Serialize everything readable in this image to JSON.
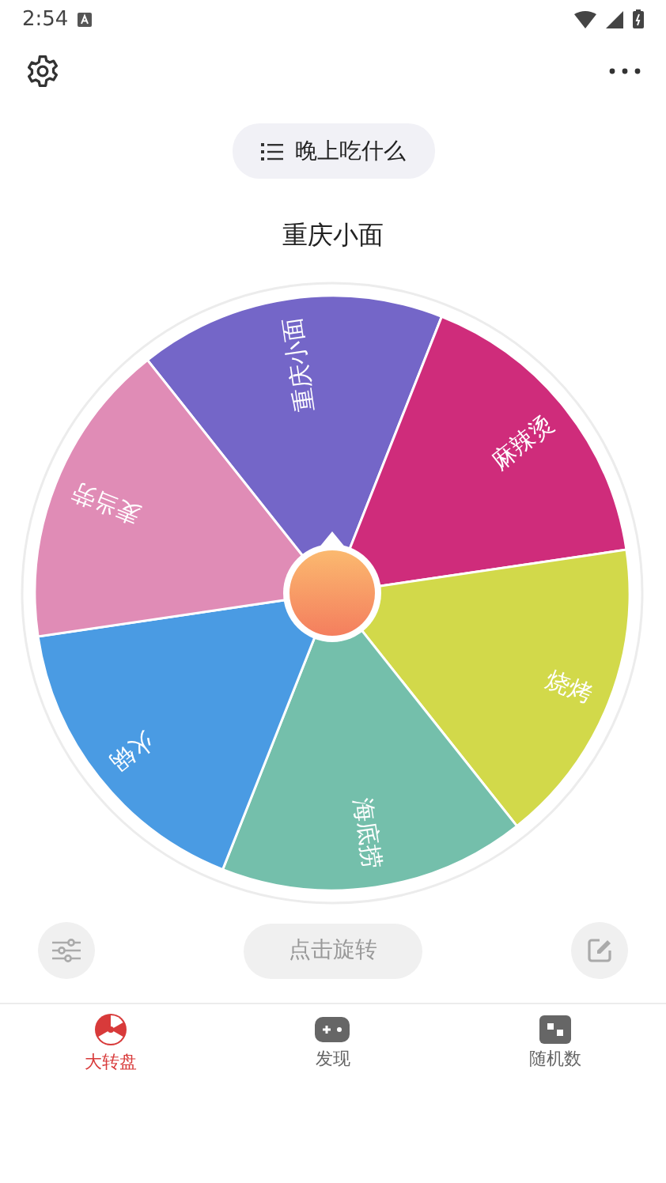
{
  "status_bar": {
    "time": "2:54"
  },
  "list_chip": {
    "label": "晚上吃什么"
  },
  "result": "重庆小面",
  "wheel": {
    "segments": [
      {
        "label": "重庆小面",
        "color": "#7466c8"
      },
      {
        "label": "麻辣烫",
        "color": "#cf2c7b"
      },
      {
        "label": "烧烤",
        "color": "#d2d94a"
      },
      {
        "label": "海底捞",
        "color": "#74bfab"
      },
      {
        "label": "火锅",
        "color": "#4a9be3"
      },
      {
        "label": "麦当劳",
        "color": "#e08cb6"
      }
    ]
  },
  "spin_button": "点击旋转",
  "tabs": [
    {
      "label": "大转盘",
      "selected": true,
      "kind": "wheel"
    },
    {
      "label": "发现",
      "selected": false,
      "kind": "gamepad"
    },
    {
      "label": "随机数",
      "selected": false,
      "kind": "dice"
    }
  ]
}
